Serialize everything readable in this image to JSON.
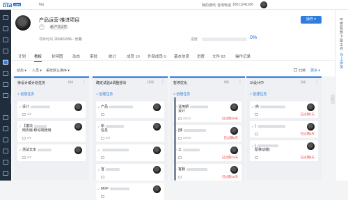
{
  "app": {
    "logo": "tita",
    "logo_suffix": ".com",
    "workspace": "Tita"
  },
  "topbar": {
    "links": [
      "我的通讯",
      "咨询电话",
      "18011241166"
    ],
    "pct": "0%"
  },
  "rightbar": {
    "lines": [
      "可查看部下属工作",
      "马上添加"
    ]
  },
  "project": {
    "title": "产品运营-推进项目",
    "manager_tag": "产品运营",
    "time_label": "项目时间",
    "time": "2018/12/06 - 长期",
    "progress_label": "进度",
    "progress": 0,
    "progress_text": "0%",
    "op_button": "操作 ▾"
  },
  "tabs": [
    {
      "label": "计划",
      "active": false
    },
    {
      "label": "看板",
      "active": true
    },
    {
      "label": "甘特图",
      "active": false
    },
    {
      "label": "动态",
      "active": false
    },
    {
      "label": "审批",
      "active": false
    },
    {
      "label": "统计",
      "active": false
    },
    {
      "label": "成员 10",
      "active": false
    },
    {
      "label": "外部成员 0",
      "active": false
    },
    {
      "label": "基本信息",
      "active": false
    },
    {
      "label": "进度",
      "active": false
    },
    {
      "label": "文件 83",
      "active": false
    },
    {
      "label": "操作记录",
      "active": false
    }
  ],
  "filters": {
    "status": "状态 ▾",
    "people": "人员 ▾",
    "sort": "系统默认排序 ▾",
    "archive": "归档",
    "more": "更多 ▾"
  },
  "columns": [
    {
      "title": "待设计或计划任务",
      "count": "0/4",
      "add": "+ 创建任务",
      "cards": [
        {
          "title": "设计",
          "meta": "0/0",
          "due": "",
          "due_style": "gray"
        },
        {
          "title": "【模块",
          "title2": "网页版-移动端使用",
          "meta": "0/0",
          "due": "",
          "due_style": "gray"
        },
        {
          "title": "测试文本",
          "meta": "0/0",
          "due": "",
          "due_style": "gray"
        }
      ]
    },
    {
      "title": "确定试验&调整想法",
      "count": "10/8",
      "add": "+ 创建任务",
      "cards": [
        {
          "title": "产品",
          "meta": "",
          "due": "",
          "due_style": "gray"
        },
        {
          "title": "新",
          "title2": "信息",
          "meta": "0/0",
          "due": "",
          "due_style": "gray"
        },
        {
          "title": "",
          "meta": "",
          "due": "",
          "due_style": "gray"
        },
        {
          "title": "官",
          "meta": "",
          "due": "",
          "due_style": "gray"
        },
        {
          "title": "MVP",
          "meta": "",
          "due": "",
          "due_style": "gray"
        }
      ]
    },
    {
      "title": "暂停优化",
      "count": "0/6",
      "add": "+ 创建任务",
      "cards": [
        {
          "title": "试用期",
          "title2": "设计",
          "meta": "05/12",
          "due": "已过期20天",
          "due_style": "red"
        },
        {
          "title": "[移",
          "meta": "00/00",
          "due": "已过期8天",
          "due_style": "red"
        },
        {
          "title": "工",
          "meta": "",
          "due": "已过期12天",
          "due_style": "red"
        },
        {
          "title": "客服",
          "meta": "",
          "due": "已过期15天",
          "due_style": "red"
        }
      ]
    },
    {
      "title": "UI设计中",
      "count": "0/4",
      "add": "+ 创建任务",
      "cards": [
        {
          "title": "[共",
          "meta": "",
          "due": "已过期1天",
          "due_style": "red"
        },
        {
          "title": "(",
          "meta": "",
          "due": "已过期3天",
          "due_style": "red"
        },
        {
          "title": "(",
          "title2": "配移动端)",
          "meta": "",
          "due": "已过期5天",
          "due_style": "red"
        }
      ]
    }
  ]
}
